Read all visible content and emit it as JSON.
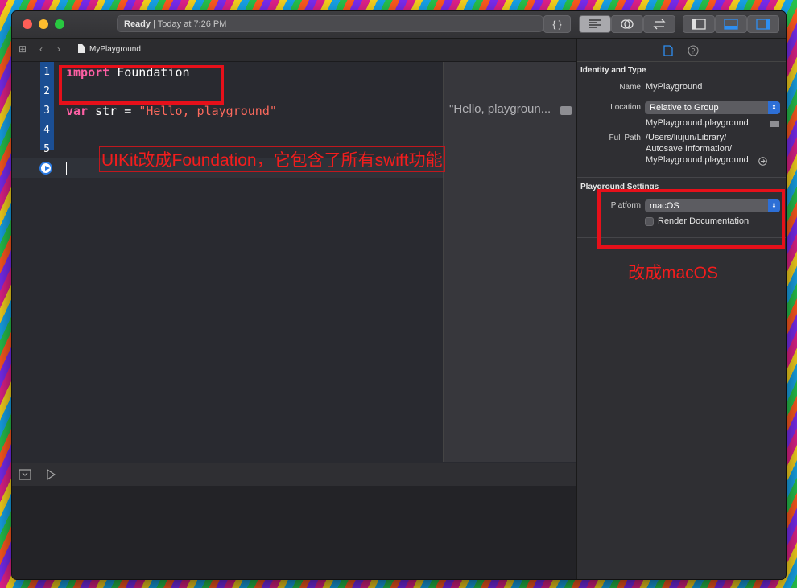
{
  "titlebar": {
    "status_strong": "Ready",
    "status_rest": "| Today at 7:26 PM",
    "braces_label": "{ }"
  },
  "jumpbar": {
    "file_name": "MyPlayground"
  },
  "editor": {
    "lines": [
      {
        "num": "1",
        "kw": "import",
        "rest": " Foundation"
      },
      {
        "num": "2"
      },
      {
        "num": "3",
        "kw": "var",
        "rest": " str = ",
        "str": "\"Hello, playground\""
      },
      {
        "num": "4"
      },
      {
        "num": "5"
      }
    ],
    "result": "\"Hello, playgroun..."
  },
  "annotations": {
    "code_note": "UIKit改成Foundation，它包含了所有swift功能",
    "platform_note": "改成macOS"
  },
  "inspector": {
    "identity_heading": "Identity and Type",
    "name_label": "Name",
    "name_value": "MyPlayground",
    "location_label": "Location",
    "location_value": "Relative to Group",
    "location_file": "MyPlayground.playground",
    "fullpath_label": "Full Path",
    "fullpath_line1": "/Users/liujun/Library/",
    "fullpath_line2": "Autosave Information/",
    "fullpath_line3": "MyPlayground.playground",
    "settings_heading": "Playground Settings",
    "platform_label": "Platform",
    "platform_value": "macOS",
    "render_doc_label": "Render Documentation",
    "render_doc_checked": false
  },
  "colors": {
    "keyword": "#fc5fa3",
    "string": "#fc6a5d",
    "annotation_red": "#e6101a",
    "accent_blue": "#2d6fd6"
  }
}
